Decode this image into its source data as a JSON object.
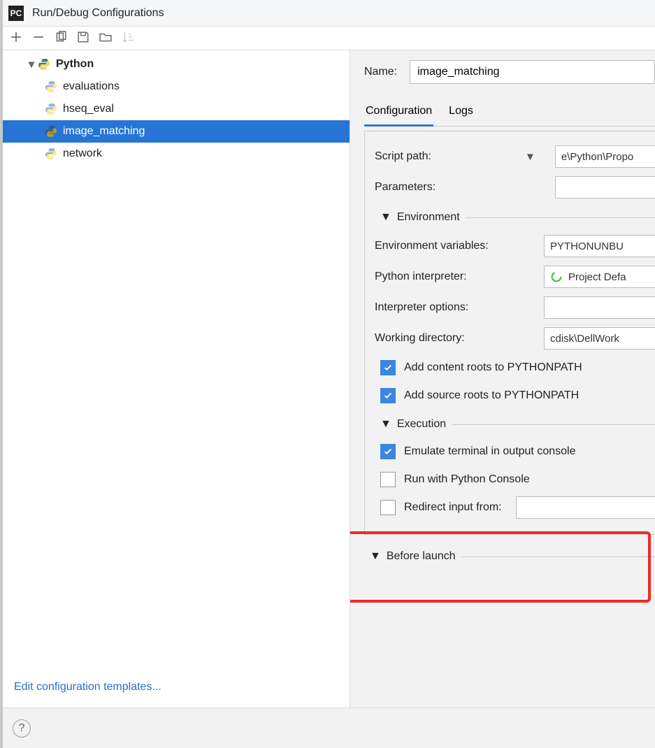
{
  "window": {
    "title": "Run/Debug Configurations"
  },
  "tree": {
    "root_label": "Python",
    "items": [
      {
        "label": "evaluations"
      },
      {
        "label": "hseq_eval"
      },
      {
        "label": "image_matching"
      },
      {
        "label": "network"
      }
    ]
  },
  "edit_templates_link": "Edit configuration templates...",
  "name_field": {
    "label": "Name:",
    "value": "image_matching"
  },
  "tabs": {
    "config": "Configuration",
    "logs": "Logs"
  },
  "form": {
    "script_path_label": "Script path:",
    "script_path_value": "e\\Python\\Propo",
    "parameters_label": "Parameters:",
    "parameters_value": "",
    "environment_header": "Environment",
    "env_vars_label": "Environment variables:",
    "env_vars_value": "PYTHONUNBU",
    "interpreter_label": "Python interpreter:",
    "interpreter_value": "Project Defa",
    "interpreter_opts_label": "Interpreter options:",
    "interpreter_opts_value": "",
    "working_dir_label": "Working directory:",
    "working_dir_value": "cdisk\\DellWork",
    "cb_content_roots": "Add content roots to PYTHONPATH",
    "cb_source_roots": "Add source roots to PYTHONPATH",
    "execution_header": "Execution",
    "cb_emulate": "Emulate terminal in output console",
    "cb_run_console": "Run with Python Console",
    "cb_redirect": "Redirect input from:",
    "before_launch_header": "Before launch"
  }
}
